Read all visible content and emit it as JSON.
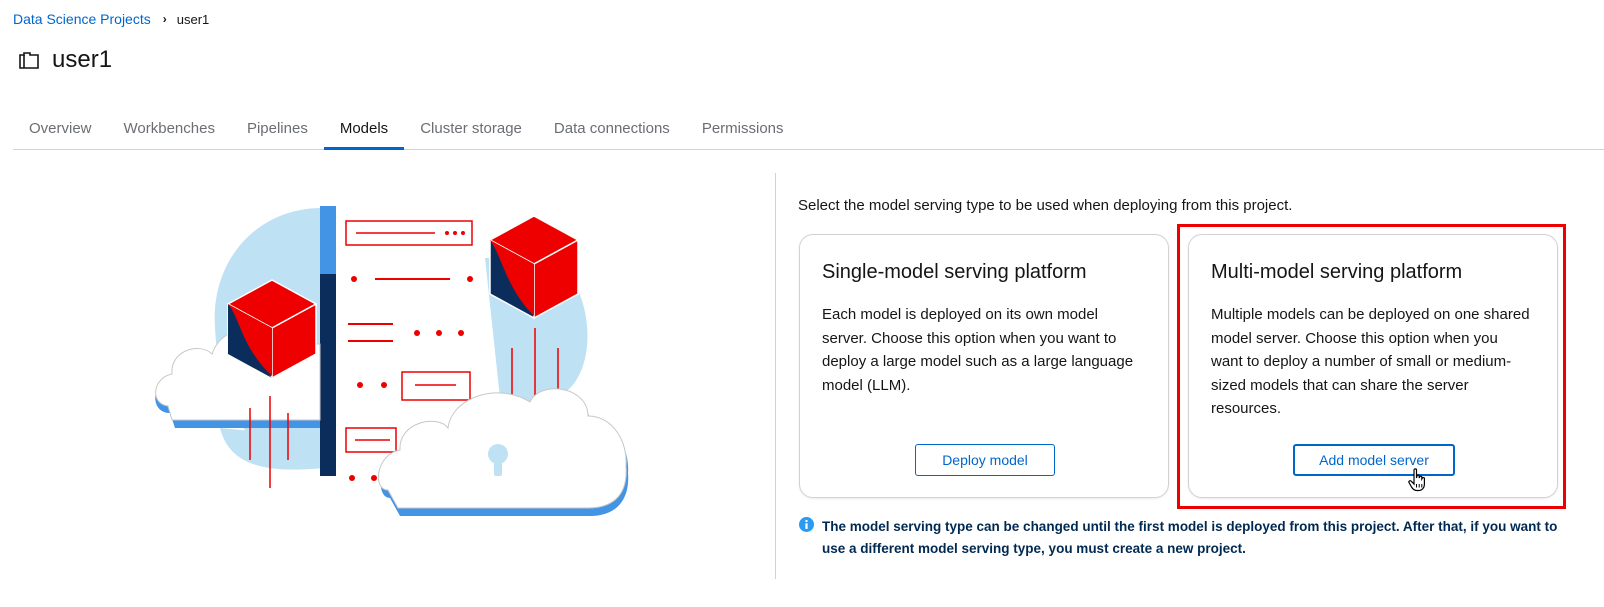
{
  "breadcrumb": {
    "parent": "Data Science Projects",
    "current": "user1"
  },
  "page": {
    "title": "user1"
  },
  "tabs": [
    {
      "label": "Overview"
    },
    {
      "label": "Workbenches"
    },
    {
      "label": "Pipelines"
    },
    {
      "label": "Models",
      "active": true
    },
    {
      "label": "Cluster storage"
    },
    {
      "label": "Data connections"
    },
    {
      "label": "Permissions"
    }
  ],
  "models": {
    "intro": "Select the model serving type to be used when deploying from this project.",
    "single": {
      "title": "Single-model serving platform",
      "description": "Each model is deployed on its own model server. Choose this option when you want to deploy a large model such as a large language model (LLM).",
      "button": "Deploy model"
    },
    "multi": {
      "title": "Multi-model serving platform",
      "description": "Multiple models can be deployed on one shared model server. Choose this option when you want to deploy a number of small or medium-sized models that can share the server resources.",
      "button": "Add model server"
    },
    "note": "The model serving type can be changed until the first model is deployed from this project. After that, if you want to use a different model serving type, you must create a new project."
  },
  "colors": {
    "link": "#0066cc",
    "highlight": "#ee0000",
    "note_text": "#002952"
  },
  "icons": {
    "project": "project-icon",
    "breadcrumb_separator": "chevron-right-icon",
    "info": "info-circle-icon",
    "cursor": "hand-pointer-icon"
  }
}
